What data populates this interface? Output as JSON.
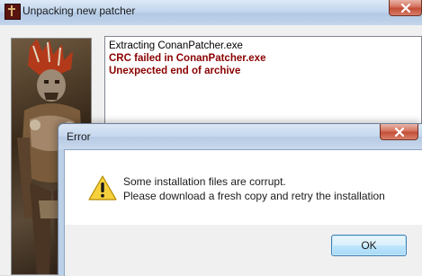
{
  "window": {
    "title": "Unpacking new patcher",
    "icon": "conan-app-icon",
    "close_icon": "close-icon"
  },
  "log": {
    "lines": [
      {
        "text": "Extracting ConanPatcher.exe",
        "style": "normal"
      },
      {
        "text": "CRC failed in ConanPatcher.exe",
        "style": "error"
      },
      {
        "text": "Unexpected end of archive",
        "style": "error"
      }
    ],
    "error_color": "#8b0000"
  },
  "dialog": {
    "title": "Error",
    "icon": "warning-icon",
    "message_line1": "Some installation files are corrupt.",
    "message_line2": "Please download a fresh copy and retry the installation",
    "ok_label": "OK"
  }
}
